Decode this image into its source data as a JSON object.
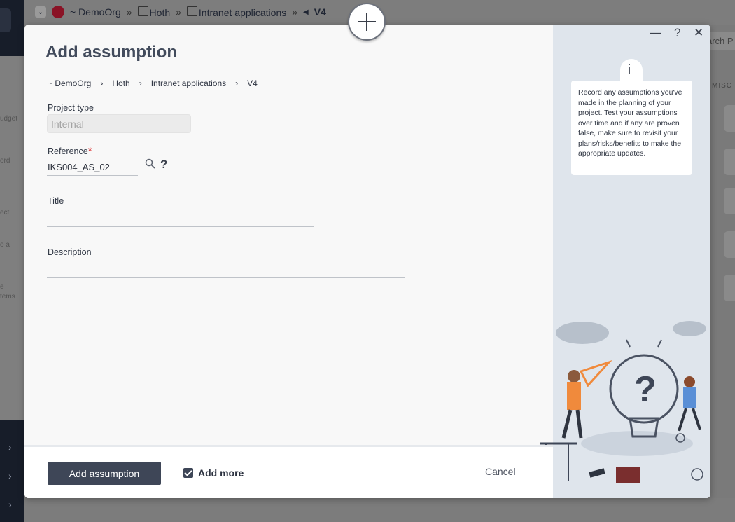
{
  "background": {
    "breadcrumb": {
      "org": "~ DemoOrg",
      "items": [
        "Hoth",
        "Intranet applications"
      ],
      "current": "V4"
    },
    "search_placeholder": "arch P",
    "misc_label": "MISC",
    "left_nav_snippets": [
      "udget",
      "ord",
      "ect",
      "o a",
      "e",
      "tems"
    ]
  },
  "modal": {
    "title": "Add assumption",
    "breadcrumb": [
      "~ DemoOrg",
      "Hoth",
      "Intranet applications",
      "V4"
    ],
    "fields": {
      "project_type": {
        "label": "Project type",
        "value": "Internal"
      },
      "reference": {
        "label": "Reference",
        "required_mark": "*",
        "value": "IKS004_AS_02"
      },
      "title": {
        "label": "Title",
        "value": ""
      },
      "description": {
        "label": "Description",
        "value": ""
      }
    },
    "help_mark": "?",
    "info_mark": "i",
    "info_text": "Record any assumptions you've made in the planning of your project. Test your assumptions over time and if any are proven false, make sure to revisit your plans/risks/benefits to make the appropriate updates.",
    "window_controls": {
      "minimize": "—",
      "help": "?",
      "close": "✕"
    },
    "footer": {
      "submit_label": "Add assumption",
      "add_more_label": "Add more",
      "add_more_checked": true,
      "cancel_label": "Cancel"
    }
  },
  "colors": {
    "primary": "#3e4657",
    "side_panel": "#dfe5ec",
    "required": "#dd3333",
    "illustration_orange": "#f08a3c",
    "illustration_blue": "#5a8fd6"
  }
}
